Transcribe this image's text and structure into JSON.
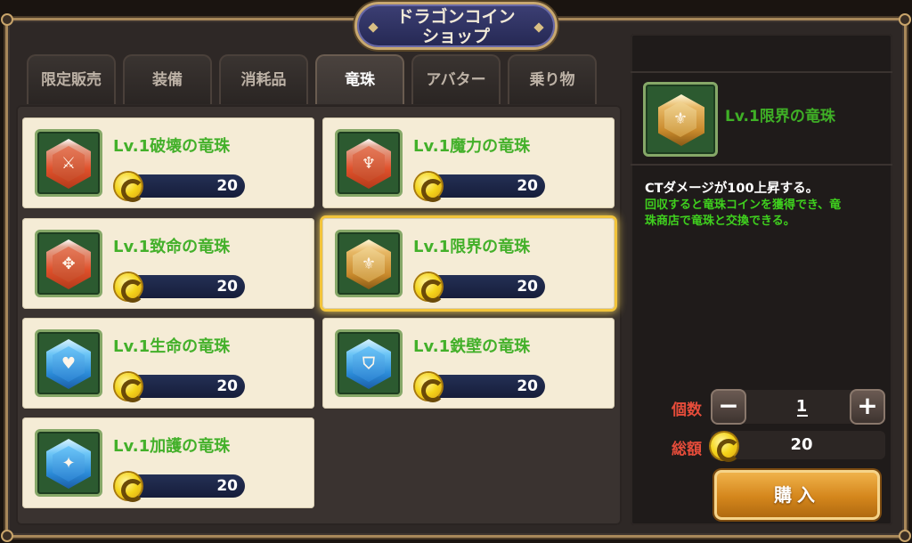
{
  "title": {
    "line1": "ドラゴンコイン",
    "line2": "ショップ"
  },
  "tabs": [
    {
      "label": "限定販売"
    },
    {
      "label": "装備"
    },
    {
      "label": "消耗品"
    },
    {
      "label": "竜珠",
      "active": true
    },
    {
      "label": "アバター"
    },
    {
      "label": "乗り物"
    }
  ],
  "items": [
    {
      "name": "Lv.1破壊の竜珠",
      "price": "20",
      "gem_color": "red",
      "icon": "sword-icon"
    },
    {
      "name": "Lv.1魔力の竜珠",
      "price": "20",
      "gem_color": "red",
      "icon": "magic-blade-icon"
    },
    {
      "name": "Lv.1致命の竜珠",
      "price": "20",
      "gem_color": "red",
      "icon": "critical-icon"
    },
    {
      "name": "Lv.1限界の竜珠",
      "price": "20",
      "gem_color": "gold",
      "icon": "crest-icon",
      "selected": true
    },
    {
      "name": "Lv.1生命の竜珠",
      "price": "20",
      "gem_color": "blue",
      "icon": "heart-icon"
    },
    {
      "name": "Lv.1鉄壁の竜珠",
      "price": "20",
      "gem_color": "blue",
      "icon": "shield-icon"
    },
    {
      "name": "Lv.1加護の竜珠",
      "price": "20",
      "gem_color": "blue",
      "icon": "star-shield-icon"
    }
  ],
  "detail": {
    "name": "Lv.1限界の竜珠",
    "effect": "CTダメージが100上昇する。",
    "note_line1": "回収すると竜珠コインを獲得でき、竜",
    "note_line2": "珠商店で竜珠と交換できる。",
    "quantity_label": "個数",
    "quantity": "1",
    "minus": "−",
    "plus": "+",
    "total_label": "総額",
    "total": "20",
    "buy_label": "購入"
  },
  "colors": {
    "name_green": "#43b02a",
    "label_red": "#e54c3a",
    "selected_glow": "#f2c43a",
    "buy_button": "#d4861c"
  }
}
